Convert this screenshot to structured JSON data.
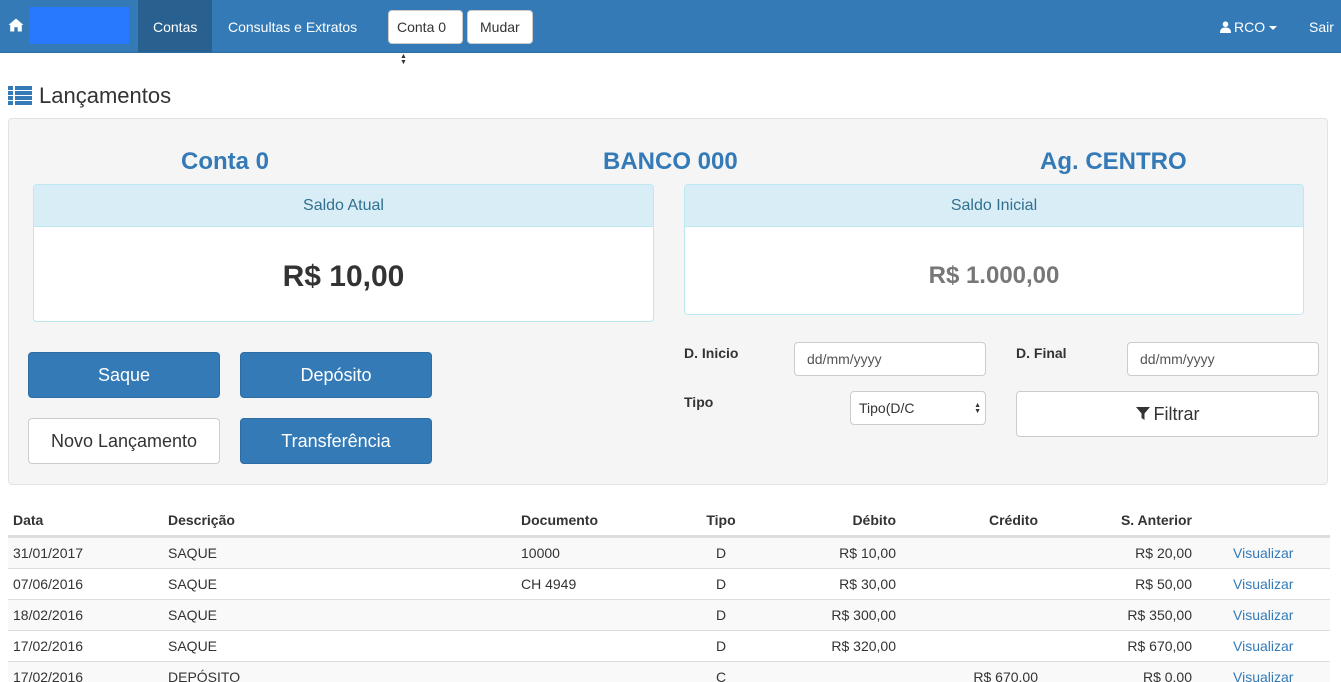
{
  "nav": {
    "contas": "Contas",
    "consultas": "Consultas e Extratos",
    "conta_select": "Conta 0",
    "mudar": "Mudar",
    "user": "RCO",
    "sair": "Sair",
    "brand_color": "#2979ff"
  },
  "page": {
    "title": "Lançamentos"
  },
  "account": {
    "conta": "Conta 0",
    "banco": "BANCO 000",
    "agencia": "Ag. CENTRO"
  },
  "saldo_atual": {
    "label": "Saldo Atual",
    "value": "R$ 10,00"
  },
  "saldo_inicial": {
    "label": "Saldo Inicial",
    "value": "R$ 1.000,00"
  },
  "buttons": {
    "saque": "Saque",
    "deposito": "Depósito",
    "novo": "Novo Lançamento",
    "transferencia": "Transferência"
  },
  "filters": {
    "d_inicio_label": "D. Inicio",
    "d_inicio_placeholder": "dd/mm/yyyy",
    "d_final_label": "D. Final",
    "d_final_placeholder": "dd/mm/yyyy",
    "tipo_label": "Tipo",
    "tipo_value": "Tipo(D/C",
    "filtrar": "Filtrar"
  },
  "table": {
    "headers": [
      "Data",
      "Descrição",
      "Documento",
      "Tipo",
      "Débito",
      "Crédito",
      "S. Anterior"
    ],
    "rows": [
      {
        "data": "31/01/2017",
        "descricao": "SAQUE",
        "documento": "10000",
        "tipo": "D",
        "debito": "R$ 10,00",
        "credito": "",
        "anterior": "R$ 20,00",
        "acao": "Visualizar"
      },
      {
        "data": "07/06/2016",
        "descricao": "SAQUE",
        "documento": "CH 4949",
        "tipo": "D",
        "debito": "R$ 30,00",
        "credito": "",
        "anterior": "R$ 50,00",
        "acao": "Visualizar"
      },
      {
        "data": "18/02/2016",
        "descricao": "SAQUE",
        "documento": "",
        "tipo": "D",
        "debito": "R$ 300,00",
        "credito": "",
        "anterior": "R$ 350,00",
        "acao": "Visualizar"
      },
      {
        "data": "17/02/2016",
        "descricao": "SAQUE",
        "documento": "",
        "tipo": "D",
        "debito": "R$ 320,00",
        "credito": "",
        "anterior": "R$ 670,00",
        "acao": "Visualizar"
      },
      {
        "data": "17/02/2016",
        "descricao": "DEPÓSITO",
        "documento": "",
        "tipo": "C",
        "debito": "",
        "credito": "R$ 670,00",
        "anterior": "R$ 0,00",
        "acao": "Visualizar"
      }
    ]
  }
}
